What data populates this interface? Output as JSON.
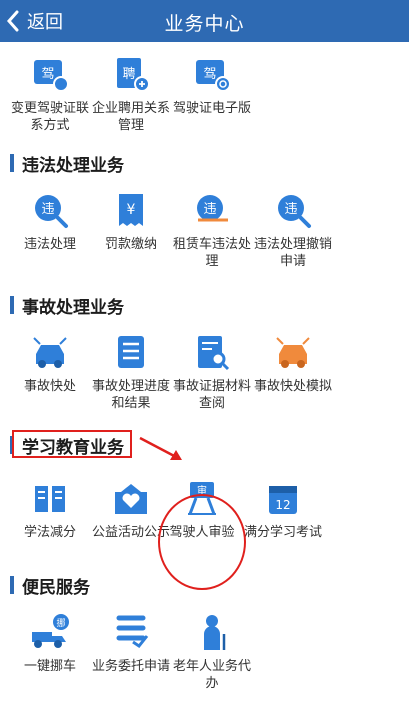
{
  "navbar": {
    "back_label": "返回",
    "title": "业务中心"
  },
  "top_row": [
    {
      "label": "变更驾驶证联系方式",
      "icon": "license-phone-icon",
      "glyph": "驾"
    },
    {
      "label": "企业聘用关系管理",
      "icon": "employment-doc-icon",
      "glyph": "聘"
    },
    {
      "label": "驾驶证电子版",
      "icon": "e-license-icon",
      "glyph": "驾"
    }
  ],
  "sections": [
    {
      "title": "违法处理业务",
      "items": [
        {
          "label": "违法处理",
          "icon": "violation-search-icon",
          "glyph": "违"
        },
        {
          "label": "罚款缴纳",
          "icon": "fine-bill-icon",
          "glyph": "¥"
        },
        {
          "label": "租赁车违法处理",
          "icon": "rental-violation-icon",
          "glyph": "违"
        },
        {
          "label": "违法处理撤销申请",
          "icon": "violation-cancel-icon",
          "glyph": "违"
        }
      ]
    },
    {
      "title": "事故处理业务",
      "items": [
        {
          "label": "事故快处",
          "icon": "car-accident-icon",
          "glyph": ""
        },
        {
          "label": "事故处理进度和结果",
          "icon": "progress-list-icon",
          "glyph": ""
        },
        {
          "label": "事故证据材料查阅",
          "icon": "evidence-search-icon",
          "glyph": ""
        },
        {
          "label": "事故快处模拟",
          "icon": "accident-sim-icon",
          "glyph": ""
        }
      ]
    },
    {
      "title": "学习教育业务",
      "items": [
        {
          "label": "学法减分",
          "icon": "book-icon",
          "glyph": ""
        },
        {
          "label": "公益活动公示",
          "icon": "charity-heart-icon",
          "glyph": ""
        },
        {
          "label": "驾驶人审验",
          "icon": "driver-review-icon",
          "glyph": "审"
        },
        {
          "label": "满分学习考试",
          "icon": "calendar-12-icon",
          "glyph": "12"
        }
      ]
    },
    {
      "title": "便民服务",
      "items": [
        {
          "label": "一键挪车",
          "icon": "tow-truck-icon",
          "glyph": "挪"
        },
        {
          "label": "业务委托申请",
          "icon": "delegate-list-icon",
          "glyph": ""
        },
        {
          "label": "老年人业务代办",
          "icon": "elderly-person-icon",
          "glyph": ""
        }
      ]
    }
  ],
  "colors": {
    "nav": "#2e6ab3",
    "icon_blue": "#2f7fd9",
    "icon_orange": "#f08a3c",
    "annotation_red": "#e0201d"
  }
}
